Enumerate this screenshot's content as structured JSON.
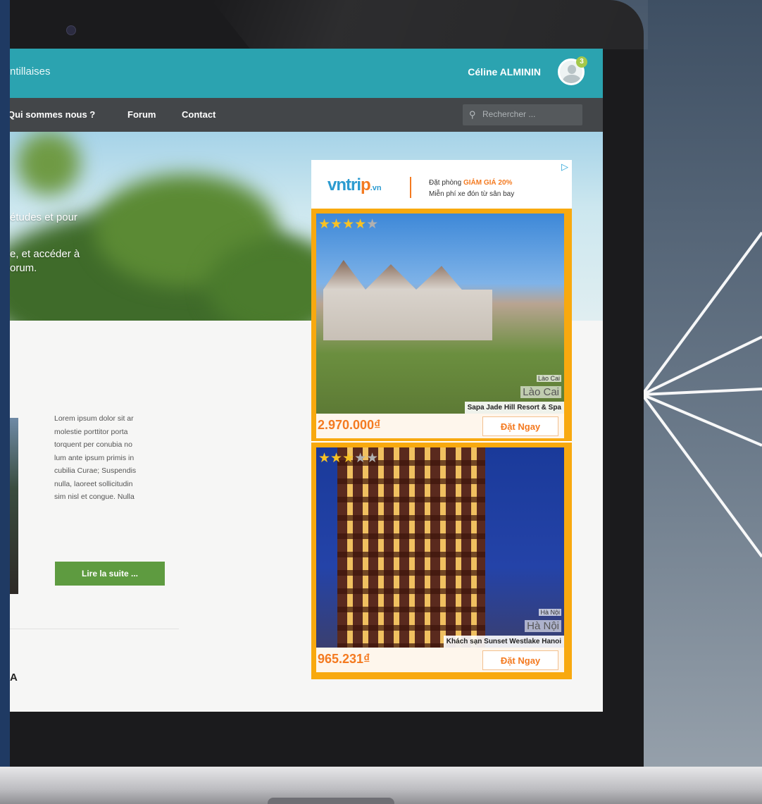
{
  "site": {
    "brand_fragment": "ntillaises",
    "user_name": "Céline ALMININ",
    "notification_count": "3"
  },
  "nav": {
    "items": [
      {
        "label": "Qui sommes nous ?"
      },
      {
        "label": "Forum"
      },
      {
        "label": "Contact"
      }
    ],
    "search_placeholder": "Rechercher ..."
  },
  "hero": {
    "lines": [
      "études et pour",
      "e, et accéder à",
      "orum."
    ]
  },
  "article": {
    "lines": [
      "Lorem ipsum dolor sit ar",
      "molestie porttitor porta",
      "torquent per conubia no",
      "lum ante ipsum primis in",
      "cubilia Curae; Suspendis",
      "nulla, laoreet sollicitudin",
      "sim nisl et congue. Nulla"
    ],
    "read_more": "Lire la suite ...",
    "next_heading_fragment": "A"
  },
  "ad": {
    "logo_main": "vntri",
    "logo_p": "p",
    "logo_suffix": ".vn",
    "promo_line1_prefix": "Đặt phòng ",
    "promo_line1_highlight": "GIẢM GIÁ 20%",
    "promo_line2": "Miễn phí xe đón từ sân bay",
    "hotels": [
      {
        "stars_on": "★★★★",
        "stars_off": "★",
        "city_small": "Lào Cai",
        "city_big": "Lào Cai",
        "name": "Sapa Jade Hill Resort & Spa",
        "price": "2.970.000₫",
        "book_label": "Đặt Ngay"
      },
      {
        "stars_on": "★★★",
        "stars_off": "★★",
        "city_small": "Hà Nội",
        "city_big": "Hà Nội",
        "name": "Khách sạn Sunset Westlake Hanoi",
        "price": "965.231₫",
        "book_label": "Đặt Ngay"
      }
    ]
  },
  "colors": {
    "topbar": "#2ba3b0",
    "navbar": "#434649",
    "read_more_button": "#5e9b40",
    "ad_border": "#f8a90f",
    "price": "#f47a20"
  }
}
